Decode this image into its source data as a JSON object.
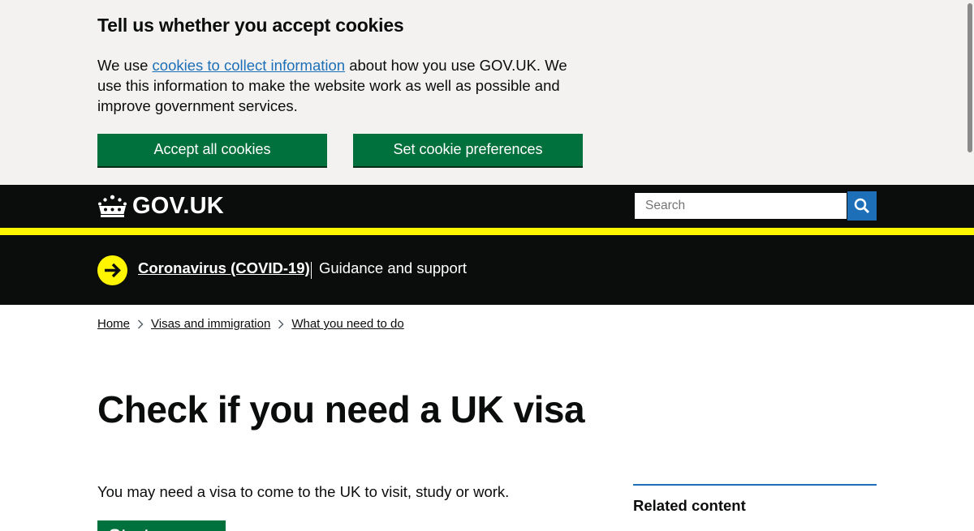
{
  "cookie_banner": {
    "title": "Tell us whether you accept cookies",
    "text_before": "We use ",
    "link_text": "cookies to collect information",
    "text_after": " about how you use GOV.UK. We use this information to make the website work as well as possible and improve government services.",
    "accept_label": "Accept all cookies",
    "prefs_label": "Set cookie preferences"
  },
  "header": {
    "logo_text": "GOV.UK",
    "search_placeholder": "Search"
  },
  "covid": {
    "link": "Coronavirus (COVID-19)",
    "subtitle": "Guidance and support"
  },
  "breadcrumbs": [
    "Home",
    "Visas and immigration",
    "What you need to do"
  ],
  "main": {
    "title": "Check if you need a UK visa",
    "lead": "You may need a visa to come to the UK to visit, study or work.",
    "start_label": "Start now"
  },
  "related": {
    "title": "Related content"
  },
  "colors": {
    "brand_green": "#00703c",
    "link_blue": "#1d70b8",
    "header_black": "#0b0c0c",
    "yellow": "#fff500"
  }
}
